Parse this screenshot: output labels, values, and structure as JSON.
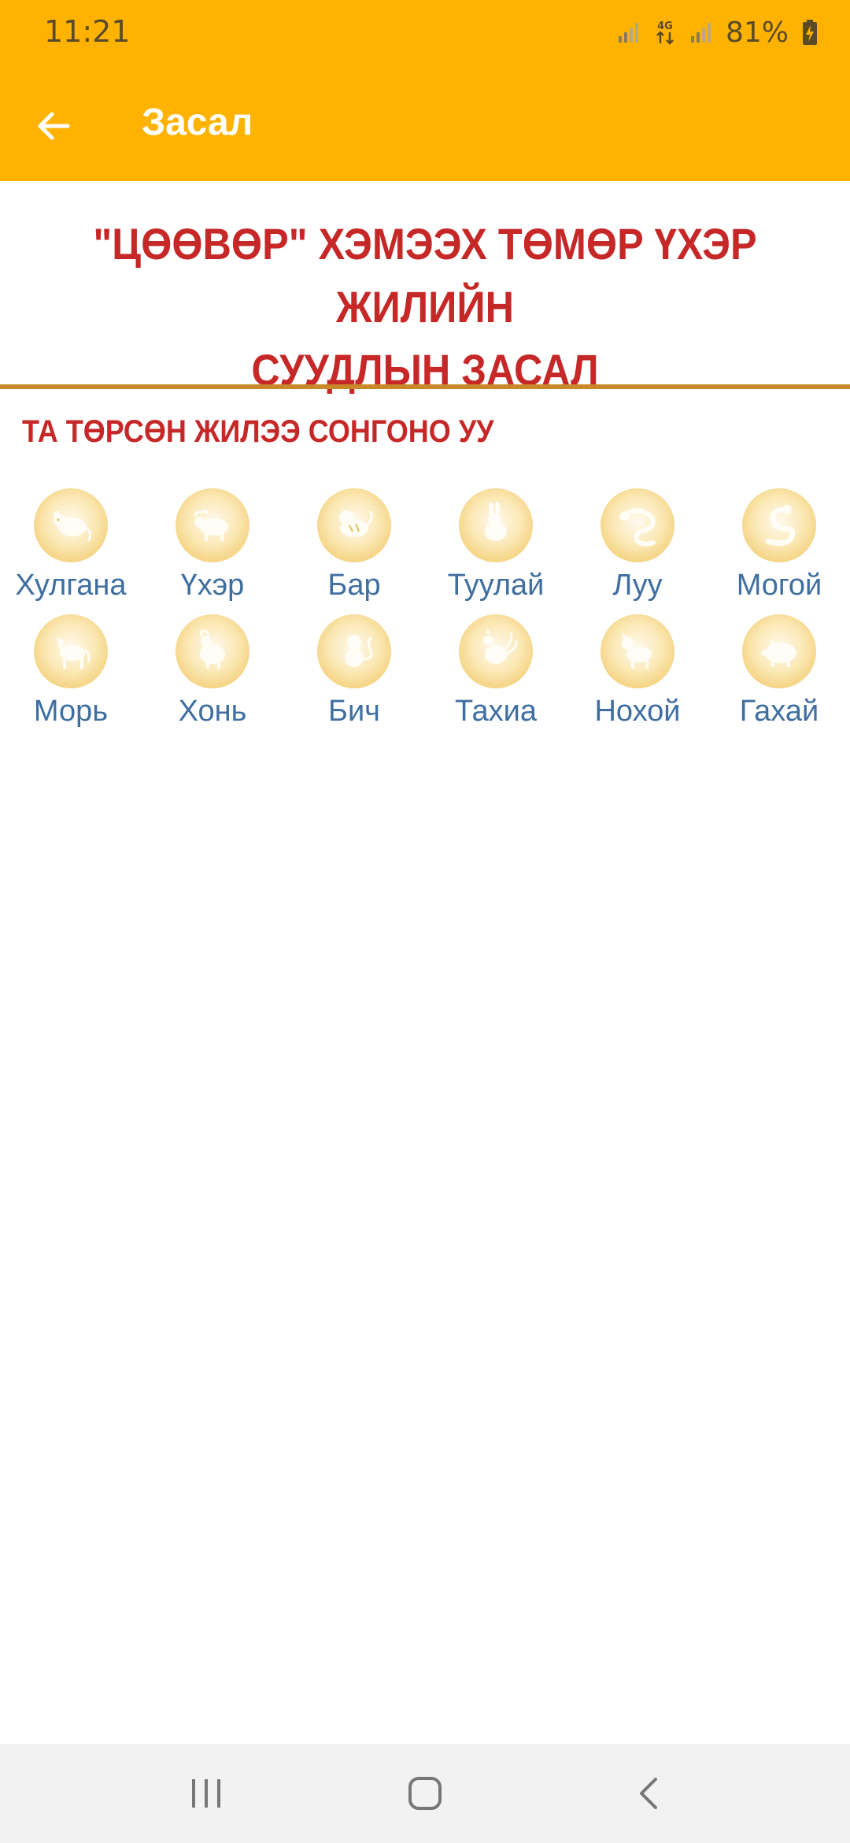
{
  "status_bar": {
    "time": "11:21",
    "network_label": "4G",
    "battery": "81%"
  },
  "app_bar": {
    "title": "Засал",
    "back_icon": "arrow-left-icon"
  },
  "heading": {
    "title_line1": "\"ЦӨӨВӨР\" ХЭМЭЭХ ТӨМӨР ҮХЭР ЖИЛИЙН",
    "title_line2": "СУУДЛЫН ЗАСАЛ",
    "prompt": "ТА ТӨРСӨН ЖИЛЭЭ СОНГОНО УУ"
  },
  "zodiac": {
    "row1": [
      {
        "label": "Хулгана",
        "icon": "rat-icon"
      },
      {
        "label": "Үхэр",
        "icon": "ox-icon"
      },
      {
        "label": "Бар",
        "icon": "tiger-icon"
      },
      {
        "label": "Туулай",
        "icon": "rabbit-icon"
      },
      {
        "label": "Луу",
        "icon": "dragon-icon"
      },
      {
        "label": "Могой",
        "icon": "snake-icon"
      }
    ],
    "row2": [
      {
        "label": "Морь",
        "icon": "horse-icon"
      },
      {
        "label": "Хонь",
        "icon": "sheep-icon"
      },
      {
        "label": "Бич",
        "icon": "monkey-icon"
      },
      {
        "label": "Тахиа",
        "icon": "rooster-icon"
      },
      {
        "label": "Нохой",
        "icon": "dog-icon"
      },
      {
        "label": "Гахай",
        "icon": "pig-icon"
      }
    ]
  },
  "colors": {
    "app_bar": "#ffb300",
    "title_red": "#c62828",
    "label_blue": "#3f6fa0",
    "divider": "#c9892b"
  },
  "nav_bar": {
    "recents_icon": "recents-icon",
    "home_icon": "home-icon",
    "back_icon": "back-chevron-icon"
  }
}
